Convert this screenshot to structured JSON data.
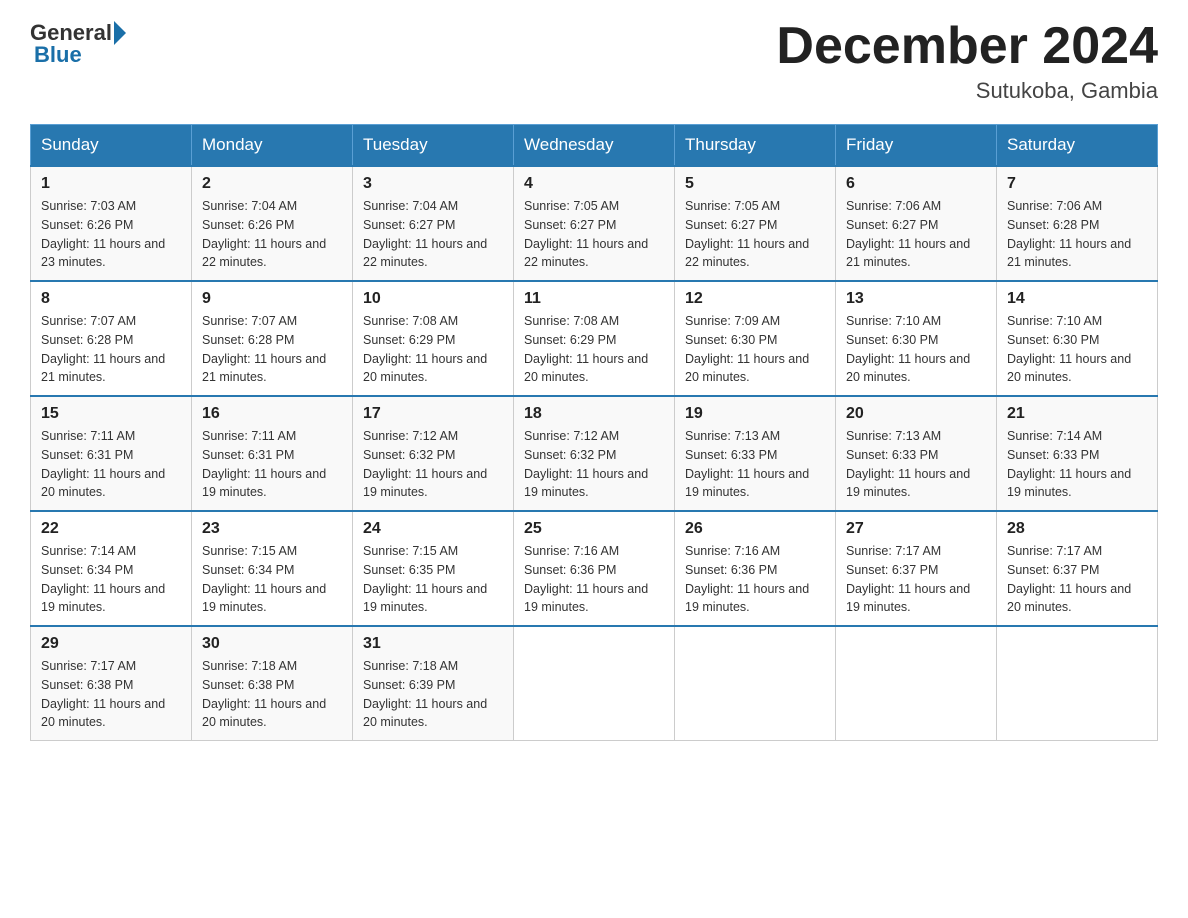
{
  "header": {
    "logo_text": "General",
    "logo_blue": "Blue",
    "month_title": "December 2024",
    "location": "Sutukoba, Gambia"
  },
  "days_of_week": [
    "Sunday",
    "Monday",
    "Tuesday",
    "Wednesday",
    "Thursday",
    "Friday",
    "Saturday"
  ],
  "weeks": [
    [
      {
        "day": "1",
        "sunrise": "7:03 AM",
        "sunset": "6:26 PM",
        "daylight": "11 hours and 23 minutes."
      },
      {
        "day": "2",
        "sunrise": "7:04 AM",
        "sunset": "6:26 PM",
        "daylight": "11 hours and 22 minutes."
      },
      {
        "day": "3",
        "sunrise": "7:04 AM",
        "sunset": "6:27 PM",
        "daylight": "11 hours and 22 minutes."
      },
      {
        "day": "4",
        "sunrise": "7:05 AM",
        "sunset": "6:27 PM",
        "daylight": "11 hours and 22 minutes."
      },
      {
        "day": "5",
        "sunrise": "7:05 AM",
        "sunset": "6:27 PM",
        "daylight": "11 hours and 22 minutes."
      },
      {
        "day": "6",
        "sunrise": "7:06 AM",
        "sunset": "6:27 PM",
        "daylight": "11 hours and 21 minutes."
      },
      {
        "day": "7",
        "sunrise": "7:06 AM",
        "sunset": "6:28 PM",
        "daylight": "11 hours and 21 minutes."
      }
    ],
    [
      {
        "day": "8",
        "sunrise": "7:07 AM",
        "sunset": "6:28 PM",
        "daylight": "11 hours and 21 minutes."
      },
      {
        "day": "9",
        "sunrise": "7:07 AM",
        "sunset": "6:28 PM",
        "daylight": "11 hours and 21 minutes."
      },
      {
        "day": "10",
        "sunrise": "7:08 AM",
        "sunset": "6:29 PM",
        "daylight": "11 hours and 20 minutes."
      },
      {
        "day": "11",
        "sunrise": "7:08 AM",
        "sunset": "6:29 PM",
        "daylight": "11 hours and 20 minutes."
      },
      {
        "day": "12",
        "sunrise": "7:09 AM",
        "sunset": "6:30 PM",
        "daylight": "11 hours and 20 minutes."
      },
      {
        "day": "13",
        "sunrise": "7:10 AM",
        "sunset": "6:30 PM",
        "daylight": "11 hours and 20 minutes."
      },
      {
        "day": "14",
        "sunrise": "7:10 AM",
        "sunset": "6:30 PM",
        "daylight": "11 hours and 20 minutes."
      }
    ],
    [
      {
        "day": "15",
        "sunrise": "7:11 AM",
        "sunset": "6:31 PM",
        "daylight": "11 hours and 20 minutes."
      },
      {
        "day": "16",
        "sunrise": "7:11 AM",
        "sunset": "6:31 PM",
        "daylight": "11 hours and 19 minutes."
      },
      {
        "day": "17",
        "sunrise": "7:12 AM",
        "sunset": "6:32 PM",
        "daylight": "11 hours and 19 minutes."
      },
      {
        "day": "18",
        "sunrise": "7:12 AM",
        "sunset": "6:32 PM",
        "daylight": "11 hours and 19 minutes."
      },
      {
        "day": "19",
        "sunrise": "7:13 AM",
        "sunset": "6:33 PM",
        "daylight": "11 hours and 19 minutes."
      },
      {
        "day": "20",
        "sunrise": "7:13 AM",
        "sunset": "6:33 PM",
        "daylight": "11 hours and 19 minutes."
      },
      {
        "day": "21",
        "sunrise": "7:14 AM",
        "sunset": "6:33 PM",
        "daylight": "11 hours and 19 minutes."
      }
    ],
    [
      {
        "day": "22",
        "sunrise": "7:14 AM",
        "sunset": "6:34 PM",
        "daylight": "11 hours and 19 minutes."
      },
      {
        "day": "23",
        "sunrise": "7:15 AM",
        "sunset": "6:34 PM",
        "daylight": "11 hours and 19 minutes."
      },
      {
        "day": "24",
        "sunrise": "7:15 AM",
        "sunset": "6:35 PM",
        "daylight": "11 hours and 19 minutes."
      },
      {
        "day": "25",
        "sunrise": "7:16 AM",
        "sunset": "6:36 PM",
        "daylight": "11 hours and 19 minutes."
      },
      {
        "day": "26",
        "sunrise": "7:16 AM",
        "sunset": "6:36 PM",
        "daylight": "11 hours and 19 minutes."
      },
      {
        "day": "27",
        "sunrise": "7:17 AM",
        "sunset": "6:37 PM",
        "daylight": "11 hours and 19 minutes."
      },
      {
        "day": "28",
        "sunrise": "7:17 AM",
        "sunset": "6:37 PM",
        "daylight": "11 hours and 20 minutes."
      }
    ],
    [
      {
        "day": "29",
        "sunrise": "7:17 AM",
        "sunset": "6:38 PM",
        "daylight": "11 hours and 20 minutes."
      },
      {
        "day": "30",
        "sunrise": "7:18 AM",
        "sunset": "6:38 PM",
        "daylight": "11 hours and 20 minutes."
      },
      {
        "day": "31",
        "sunrise": "7:18 AM",
        "sunset": "6:39 PM",
        "daylight": "11 hours and 20 minutes."
      },
      null,
      null,
      null,
      null
    ]
  ]
}
